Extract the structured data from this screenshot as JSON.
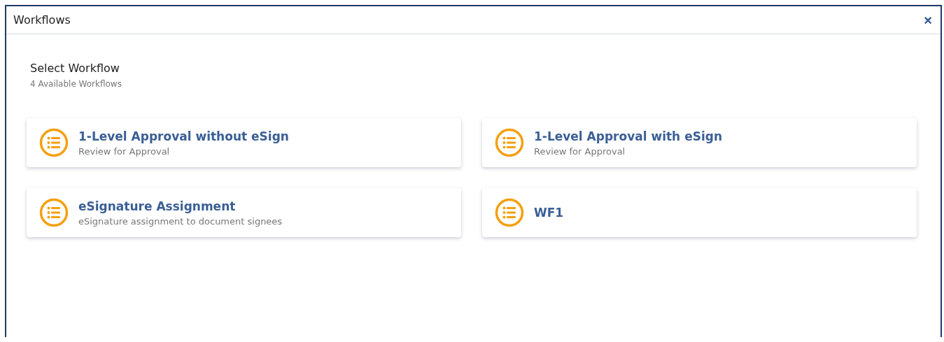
{
  "window": {
    "title": "Workflows",
    "close": "×"
  },
  "heading": "Select Workflow",
  "subheading": "4 Available Workflows",
  "workflows": [
    {
      "name": "1-Level Approval without eSign",
      "description": "Review for Approval"
    },
    {
      "name": "1-Level Approval with eSign",
      "description": "Review for Approval"
    },
    {
      "name": "eSignature Assignment",
      "description": "eSignature assignment to document signees"
    },
    {
      "name": "WF1"
    }
  ]
}
